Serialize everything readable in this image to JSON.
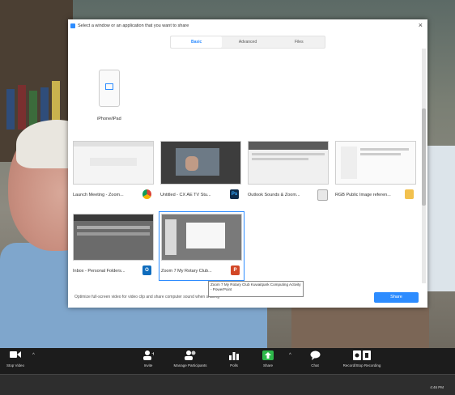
{
  "dialog": {
    "title": "Select a window or an application that you want to share",
    "close_glyph": "×",
    "tabs": [
      {
        "label": "Basic",
        "active": true
      },
      {
        "label": "Advanced",
        "active": false
      },
      {
        "label": "Files",
        "active": false
      }
    ],
    "iphone_label": "iPhone/iPad",
    "windows": [
      {
        "label": "Launch Meeting - Zoom...",
        "app": "chrome-icon"
      },
      {
        "label": "Untitled - CX AE TV Stu...",
        "app": "photoshop-icon",
        "badge": "Ps"
      },
      {
        "label": "Outlook Sounds & Zoom...",
        "app": "file-icon"
      },
      {
        "label": "RGB Public Image referen...",
        "app": "folder-icon"
      },
      {
        "label": "Inbox - Personal Folders...",
        "app": "outlook-icon",
        "badge": "O"
      },
      {
        "label": "Zoom 7 My Rotary Club...",
        "app": "powerpoint-icon",
        "badge": "P"
      }
    ],
    "tooltip": "Zoom 7 My Rotary Club Kuwaitpark Computing Activity - PowerPoint",
    "footer_text": "Optimize full-screen video for video clip and share computer sound when sharing",
    "share_label": "Share"
  },
  "toolbar": {
    "items": [
      {
        "label": "Stop Video",
        "icon": "video-icon"
      },
      {
        "label": "Invite",
        "icon": "invite-icon"
      },
      {
        "label": "Manage Participants",
        "icon": "participants-icon"
      },
      {
        "label": "Polls",
        "icon": "polls-icon"
      },
      {
        "label": "Share",
        "icon": "share-icon"
      },
      {
        "label": "Chat",
        "icon": "chat-icon"
      },
      {
        "label": "Record/Stop Recording",
        "icon": "record-icon"
      }
    ],
    "caret": "^"
  },
  "taskbar": {
    "clock": "4:46 PM"
  },
  "colors": {
    "accent": "#2d8cff",
    "toolbar_bg": "#1c1c1c",
    "share_green": "#2eb84b"
  }
}
